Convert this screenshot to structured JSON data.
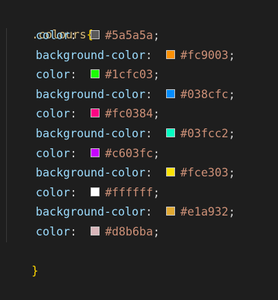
{
  "selector": ".colours",
  "open_brace": "{",
  "close_brace": "}",
  "declarations": [
    {
      "property": "color",
      "value": "#5a5a5a",
      "swatch": "#5a5a5a"
    },
    {
      "property": "background-color",
      "value": "#fc9003",
      "swatch": "#fc9003"
    },
    {
      "property": "color",
      "value": "#1cfc03",
      "swatch": "#1cfc03"
    },
    {
      "property": "background-color",
      "value": "#038cfc",
      "swatch": "#038cfc"
    },
    {
      "property": "color",
      "value": "#fc0384",
      "swatch": "#fc0384"
    },
    {
      "property": "background-color",
      "value": "#03fcc2",
      "swatch": "#03fcc2"
    },
    {
      "property": "color",
      "value": "#c603fc",
      "swatch": "#c603fc"
    },
    {
      "property": "background-color",
      "value": "#fce303",
      "swatch": "#fce303"
    },
    {
      "property": "color",
      "value": "#ffffff",
      "swatch": "#ffffff"
    },
    {
      "property": "background-color",
      "value": "#e1a932",
      "swatch": "#e1a932"
    },
    {
      "property": "color",
      "value": "#d8b6ba",
      "swatch": "#d8b6ba"
    }
  ],
  "punctuation": {
    "colon": ":",
    "semicolon": ";"
  },
  "theme": {
    "background": "#1e1e1e",
    "selector_color": "#d7ba7d",
    "brace_color": "#ffd700",
    "property_color": "#9cdcfe",
    "value_color": "#ce9178"
  }
}
